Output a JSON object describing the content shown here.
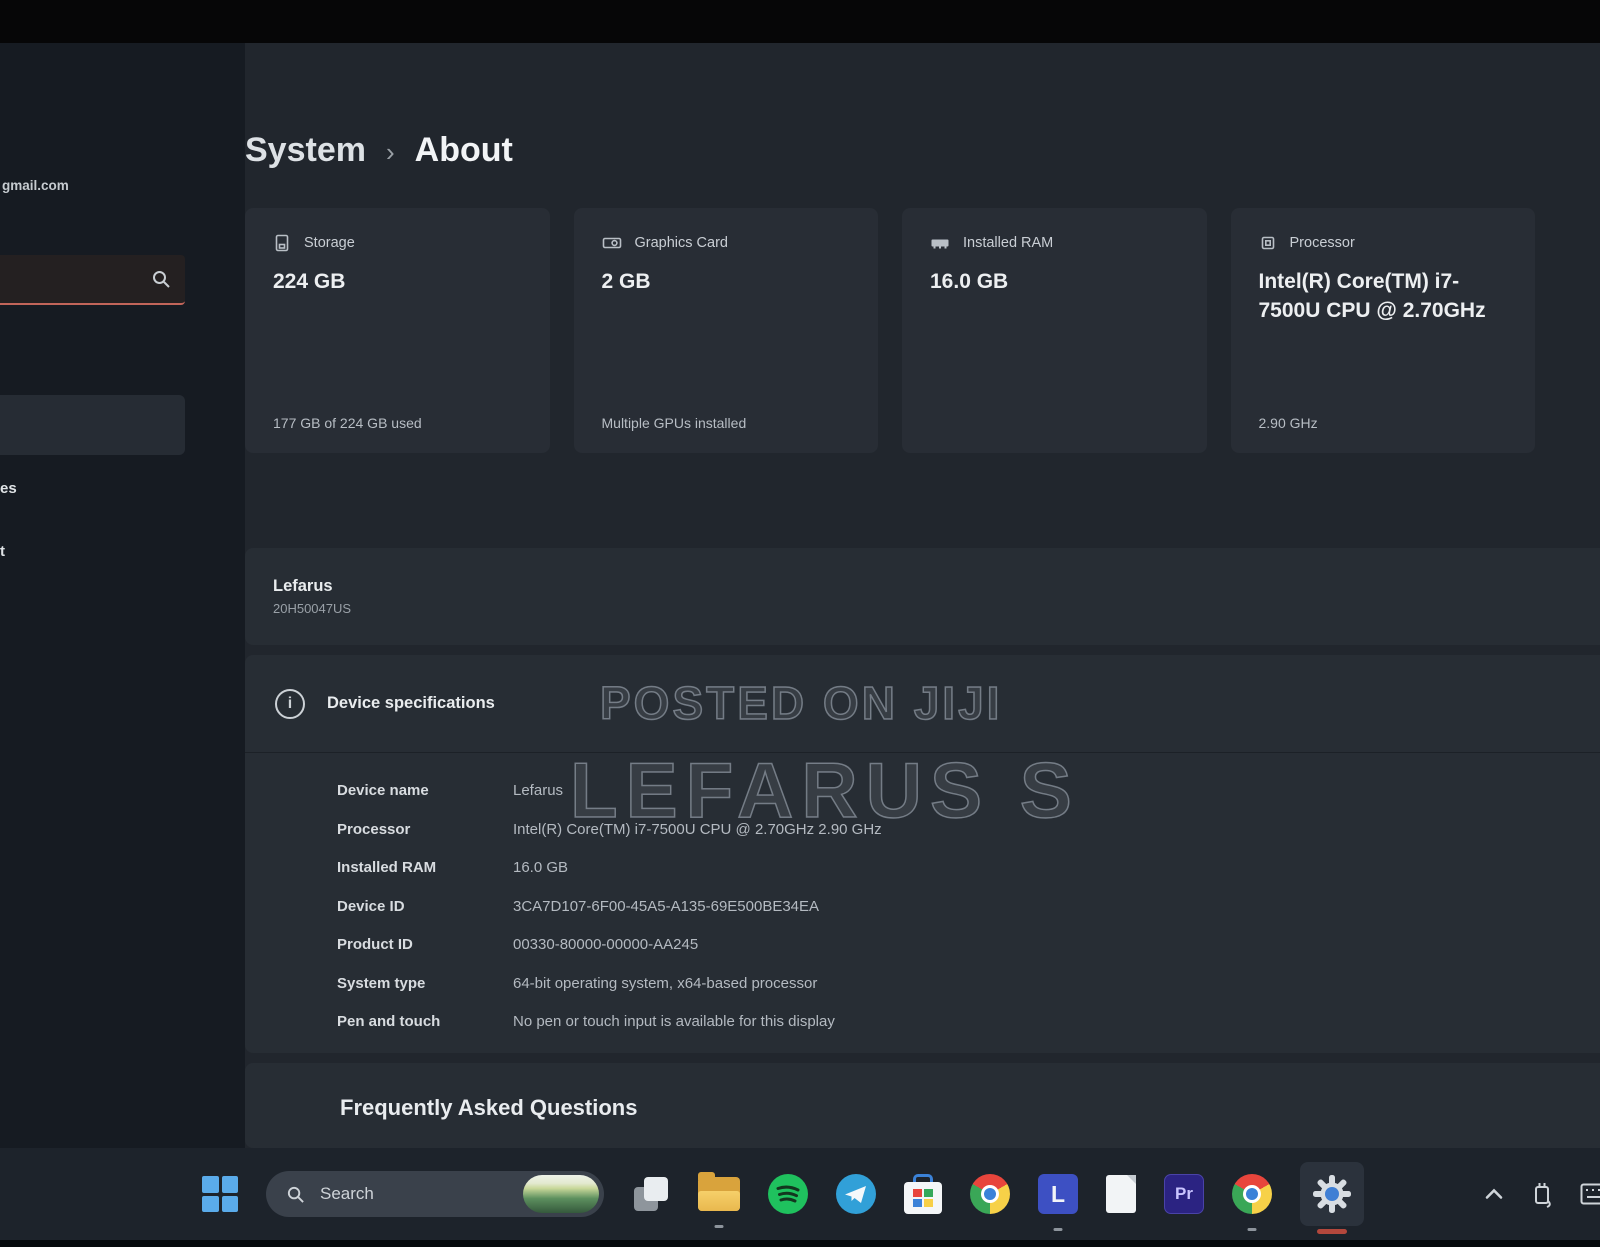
{
  "colors": {
    "search_accent": "#c2655a",
    "settings_indicator": "#b3473c",
    "start_blue": "#5aabea",
    "card_background": "#282d35",
    "taskbar_background": "#1d232b"
  },
  "sidebar": {
    "account_email": "gmail.com",
    "search_value": "",
    "items": [
      {
        "label": "es"
      },
      {
        "label": "t"
      }
    ]
  },
  "breadcrumb": {
    "parent": "System",
    "separator": "›",
    "current": "About"
  },
  "overview_cards": [
    {
      "icon": "storage-icon",
      "label": "Storage",
      "value": "224 GB",
      "caption": "177 GB of 224 GB used"
    },
    {
      "icon": "graphics-card-icon",
      "label": "Graphics Card",
      "value": "2 GB",
      "caption": "Multiple GPUs installed"
    },
    {
      "icon": "ram-icon",
      "label": "Installed RAM",
      "value": "16.0 GB",
      "caption": ""
    },
    {
      "icon": "processor-icon",
      "label": "Processor",
      "value": "Intel(R) Core(TM) i7-7500U CPU @ 2.70GHz",
      "caption": "2.90 GHz"
    }
  ],
  "device_banner": {
    "name": "Lefarus",
    "model": "20H50047US"
  },
  "device_specs": {
    "title": "Device specifications",
    "rows": [
      {
        "label": "Device name",
        "value": "Lefarus"
      },
      {
        "label": "Processor",
        "value": "Intel(R) Core(TM) i7-7500U CPU @ 2.70GHz  2.90 GHz"
      },
      {
        "label": "Installed RAM",
        "value": "16.0 GB"
      },
      {
        "label": "Device ID",
        "value": "3CA7D107-6F00-45A5-A135-69E500BE34EA"
      },
      {
        "label": "Product ID",
        "value": "00330-80000-00000-AA245"
      },
      {
        "label": "System type",
        "value": "64-bit operating system, x64-based processor"
      },
      {
        "label": "Pen and touch",
        "value": "No pen or touch input is available for this display"
      }
    ]
  },
  "faq": {
    "title": "Frequently Asked Questions"
  },
  "watermark": {
    "line1": "POSTED ON JIJI",
    "line2": "LEFARUS S"
  },
  "taskbar": {
    "search_label": "Search",
    "l_app_label": "L",
    "premiere_label": "Pr"
  }
}
